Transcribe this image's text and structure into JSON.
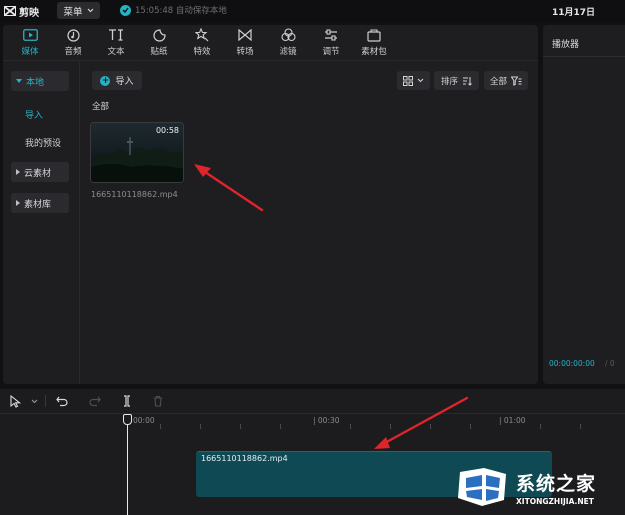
{
  "app": {
    "name": "剪映",
    "menu_label": "菜单",
    "autosave_text": "15:05:48 自动保存本地",
    "date": "11月17日"
  },
  "tabs": [
    {
      "label": "媒体",
      "icon": "media-icon",
      "active": true
    },
    {
      "label": "音频",
      "icon": "audio-icon"
    },
    {
      "label": "文本",
      "icon": "text-icon"
    },
    {
      "label": "贴纸",
      "icon": "sticker-icon"
    },
    {
      "label": "特效",
      "icon": "effects-icon"
    },
    {
      "label": "转场",
      "icon": "transition-icon"
    },
    {
      "label": "滤镜",
      "icon": "filter-icon"
    },
    {
      "label": "调节",
      "icon": "adjust-icon"
    },
    {
      "label": "素材包",
      "icon": "material-pack-icon"
    }
  ],
  "sidebar": {
    "local": "本地",
    "import": "导入",
    "presets": "我的预设",
    "cloud": "云素材",
    "library": "素材库"
  },
  "content": {
    "import_button": "导入",
    "sort_label": "排序",
    "filter_label": "全部",
    "section_label": "全部",
    "media_items": [
      {
        "name": "1665110118862.mp4",
        "duration": "00:58"
      }
    ]
  },
  "player": {
    "title": "播放器",
    "current_time": "00:00:00:00",
    "total_time": "/ 0"
  },
  "timeline": {
    "ticks": [
      "00:00",
      "| 00:30",
      "| 01:00"
    ],
    "clip_name": "1665110118862.mp4"
  },
  "watermark": {
    "title": "系统之家",
    "url": "XITONGZHIJIA.NET"
  },
  "colors": {
    "accent": "#26b3c4",
    "annotation_arrow": "#e0242b",
    "clip": "#0f4a54"
  }
}
